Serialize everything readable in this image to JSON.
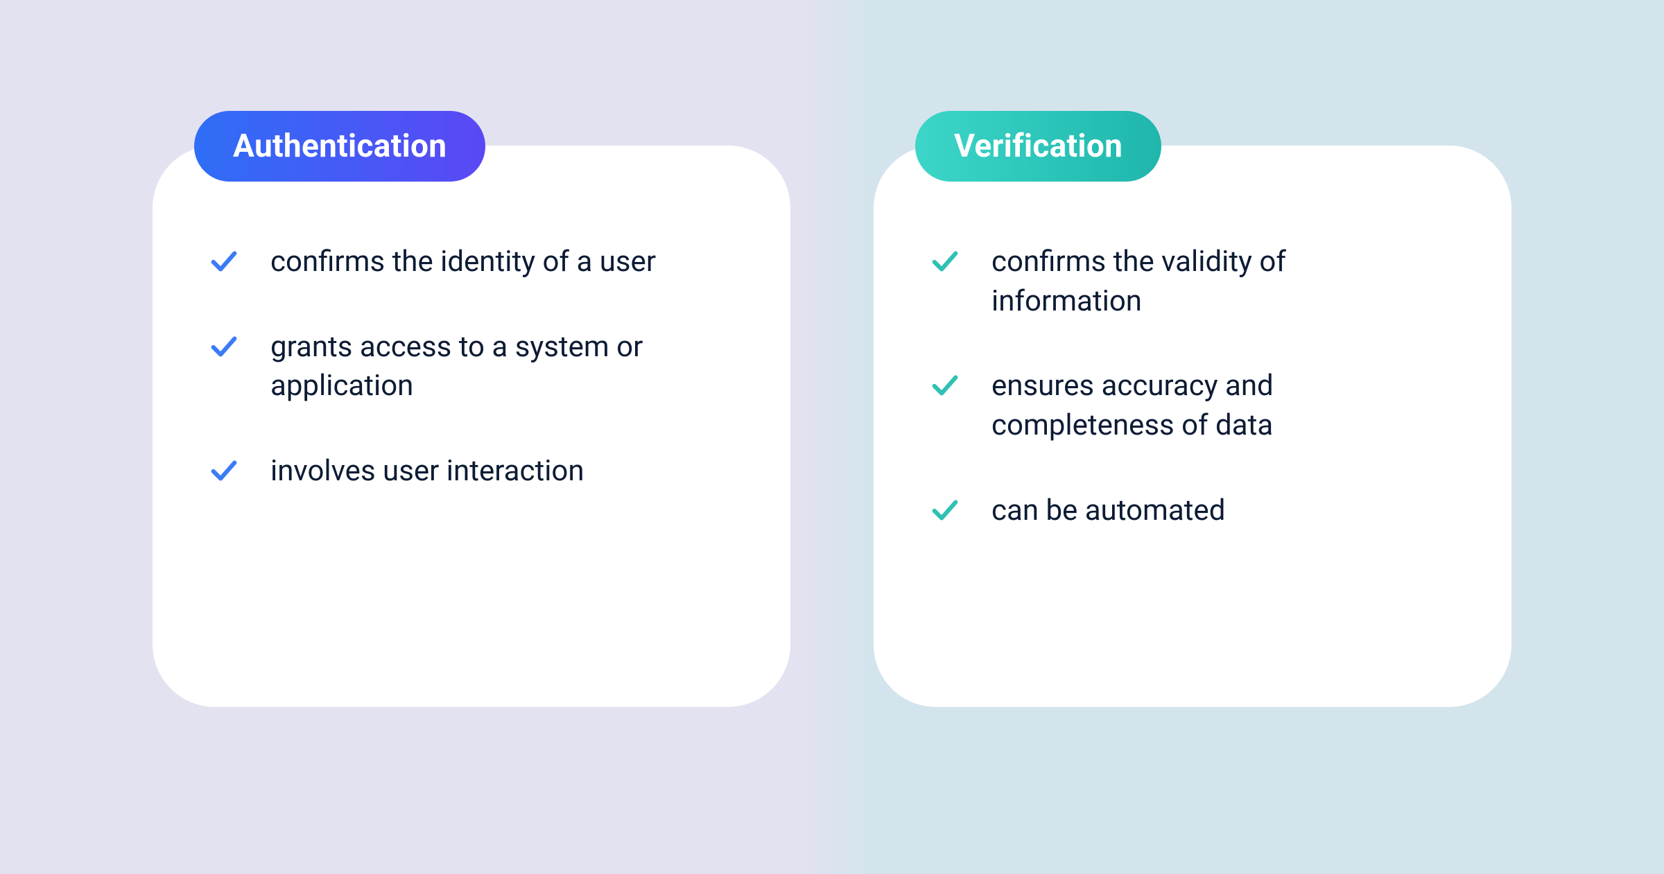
{
  "cards": {
    "auth": {
      "title": "Authentication",
      "items": [
        "confirms the identity of a user",
        "grants access to a system or application",
        "involves user interaction"
      ]
    },
    "verif": {
      "title": "Verification",
      "items": [
        "confirms the validity of information",
        "ensures accuracy and completeness of data",
        "can be automated"
      ]
    }
  },
  "colors": {
    "auth_gradient_start": "#2f6ef6",
    "auth_gradient_end": "#5a48f5",
    "verif_gradient_start": "#3cd6c8",
    "verif_gradient_end": "#1fb6ac",
    "text": "#0d1b34",
    "card_bg": "#ffffff",
    "bg_left": "#e3e2f1",
    "bg_right": "#d4e4ed"
  }
}
